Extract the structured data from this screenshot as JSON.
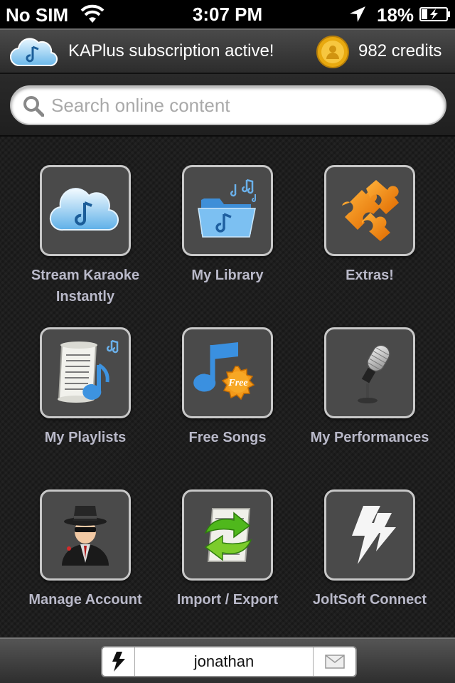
{
  "status_bar": {
    "carrier": "No SIM",
    "time": "3:07 PM",
    "battery": "18%"
  },
  "banner": {
    "subscription_text": "KAPlus subscription active!",
    "credits": "982 credits"
  },
  "search": {
    "placeholder": "Search online content"
  },
  "tiles": [
    {
      "label": "Stream Karaoke Instantly",
      "icon": "cloud-music-icon"
    },
    {
      "label": "My Library",
      "icon": "folder-music-icon"
    },
    {
      "label": "Extras!",
      "icon": "puzzle-icon"
    },
    {
      "label": "My Playlists",
      "icon": "playlist-scroll-icon"
    },
    {
      "label": "Free Songs",
      "icon": "free-note-icon"
    },
    {
      "label": "My Performances",
      "icon": "microphone-icon"
    },
    {
      "label": "Manage Account",
      "icon": "agent-avatar-icon"
    },
    {
      "label": "Import / Export",
      "icon": "sync-arrows-icon"
    },
    {
      "label": "JoltSoft Connect",
      "icon": "lightning-icon"
    }
  ],
  "bottom_bar": {
    "username": "jonathan"
  },
  "colors": {
    "label": "#b9b9c9",
    "tile_border": "#c8c8c8",
    "tile_fill": "#4a4a4a",
    "coin": "#f2b51d",
    "cloud": "#9fd3f5"
  }
}
